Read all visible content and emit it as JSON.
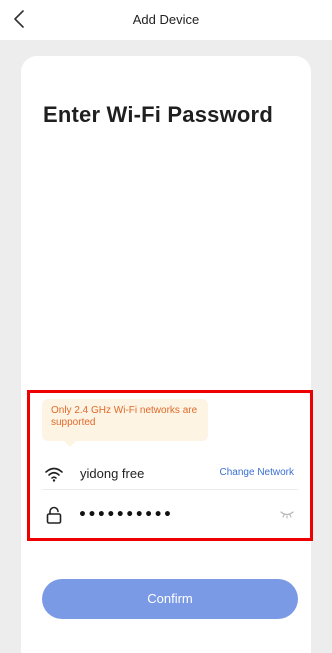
{
  "header": {
    "title": "Add Device",
    "back_icon": "chevron-left-icon"
  },
  "main": {
    "heading": "Enter Wi-Fi Password",
    "notice": "Only 2.4 GHz Wi-Fi networks are supported",
    "wifi": {
      "icon": "wifi-icon",
      "ssid": "yidong free",
      "change_label": "Change Network"
    },
    "password": {
      "icon": "lock-icon",
      "value": "••••••••••",
      "toggle_icon": "eye-closed-icon"
    },
    "confirm_label": "Confirm"
  },
  "colors": {
    "background": "#ededed",
    "card": "#ffffff",
    "accent_button": "#7b9ae6",
    "link": "#3b6fd1",
    "notice_text": "#e06a2a",
    "notice_bg": "#fdf4e4",
    "highlight_border": "#ee0000"
  }
}
